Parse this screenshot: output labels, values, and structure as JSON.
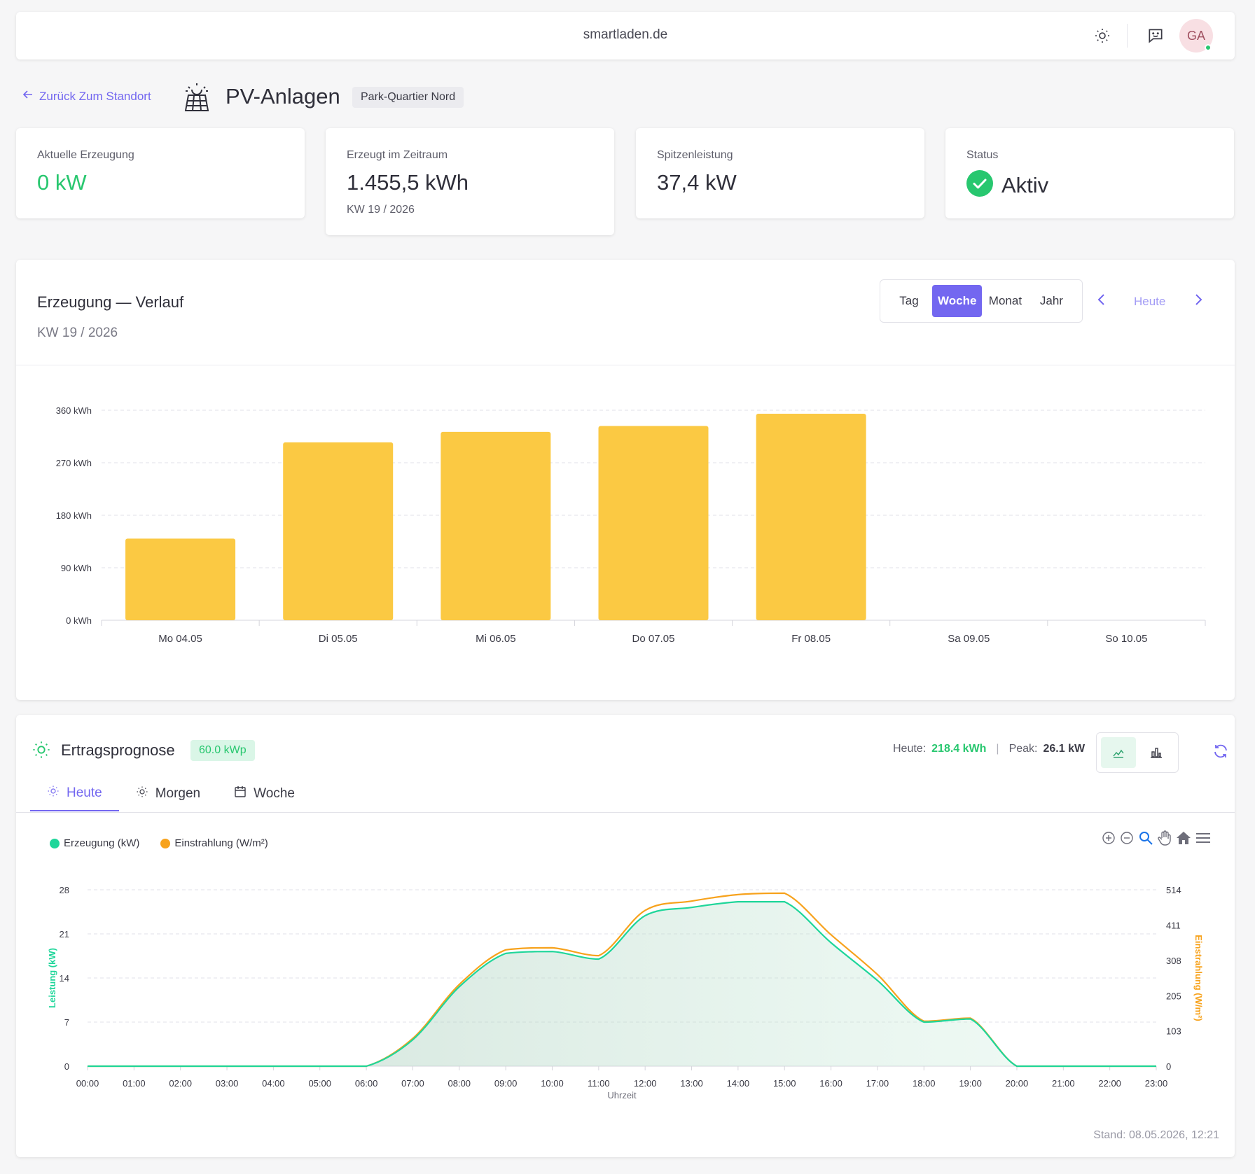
{
  "topbar": {
    "site": "smartladen.de",
    "avatar_initials": "GA"
  },
  "header": {
    "back_label": "Zurück Zum Standort",
    "title": "PV-Anlagen",
    "location": "Park-Quartier Nord"
  },
  "kpis": {
    "current": {
      "label": "Aktuelle Erzeugung",
      "value": "0 kW"
    },
    "period": {
      "label": "Erzeugt im Zeitraum",
      "value": "1.455,5 kWh",
      "sub": "KW 19 / 2026"
    },
    "peak": {
      "label": "Spitzenleistung",
      "value": "37,4 kW"
    },
    "status": {
      "label": "Status",
      "value": "Aktiv"
    }
  },
  "history": {
    "title": "Erzeugung — Verlauf",
    "subtitle": "KW 19 / 2026",
    "ranges": [
      "Tag",
      "Woche",
      "Monat",
      "Jahr"
    ],
    "active_range": "Woche",
    "today_label": "Heute"
  },
  "forecast": {
    "title": "Ertragsprognose",
    "capacity": "60.0 kWp",
    "today_label": "Heute:",
    "today_value": "218.4 kWh",
    "separator": "|",
    "peak_label": "Peak:",
    "peak_value": "26.1 kW",
    "tabs": [
      "Heute",
      "Morgen",
      "Woche"
    ],
    "active_tab": "Heute",
    "stand": "Stand: 08.05.2026, 12:21"
  },
  "colors": {
    "accent": "#7367f0",
    "success": "#28c76f",
    "bar": "#fbc943",
    "gen": "#1fd69a",
    "irr": "#f7a21c"
  },
  "chart_data": [
    {
      "type": "bar",
      "categories": [
        "Mo 04.05",
        "Di 05.05",
        "Mi 06.05",
        "Do 07.05",
        "Fr 08.05",
        "Sa 09.05",
        "So 10.05"
      ],
      "values": [
        140,
        305,
        323,
        333,
        354,
        0,
        0
      ],
      "ylim": [
        0,
        360
      ],
      "yticks": [
        "0 kWh",
        "90 kWh",
        "180 kWh",
        "270 kWh",
        "360 kWh"
      ],
      "ytick_values": [
        0,
        90,
        180,
        270,
        360
      ],
      "grid": true
    },
    {
      "type": "area",
      "x": [
        "00:00",
        "01:00",
        "02:00",
        "03:00",
        "04:00",
        "05:00",
        "06:00",
        "07:00",
        "08:00",
        "09:00",
        "10:00",
        "11:00",
        "12:00",
        "13:00",
        "14:00",
        "15:00",
        "16:00",
        "17:00",
        "18:00",
        "19:00",
        "20:00",
        "21:00",
        "22:00",
        "23:00"
      ],
      "xlabel": "Uhrzeit",
      "ylabel": "Leistung (kW)",
      "y2label": "Einstrahlung (W/m²)",
      "ylim": [
        0,
        28
      ],
      "y2lim": [
        0,
        514
      ],
      "yticks": [
        0,
        7,
        14,
        21,
        28
      ],
      "y2ticks": [
        0,
        103,
        205,
        308,
        411,
        514
      ],
      "grid": true,
      "legend": "top-left",
      "series": [
        {
          "name": "Erzeugung (kW)",
          "axis": "left",
          "values": [
            0,
            0,
            0,
            0,
            0,
            0,
            0,
            4.2,
            12.6,
            17.9,
            18.2,
            17.0,
            23.9,
            25.2,
            26.1,
            26.1,
            19.6,
            13.6,
            7.0,
            7.5,
            0,
            0,
            0,
            0
          ]
        },
        {
          "name": "Einstrahlung (W/m²)",
          "axis": "right",
          "values": [
            0,
            0,
            0,
            0,
            0,
            0,
            0,
            81,
            238,
            339,
            345,
            322,
            454,
            481,
            500,
            504,
            383,
            267,
            131,
            140,
            0,
            0,
            0,
            0
          ]
        }
      ]
    }
  ]
}
